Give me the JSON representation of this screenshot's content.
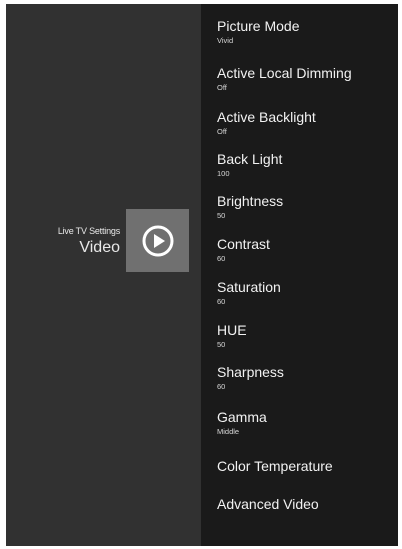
{
  "section": {
    "subtitle": "Live TV Settings",
    "title": "Video",
    "icon": "play-circle-icon"
  },
  "menu": {
    "items": [
      {
        "label": "Picture Mode",
        "value": "Vivid"
      },
      {
        "label": "Active Local Dimming",
        "value": "Off"
      },
      {
        "label": "Active Backlight",
        "value": "Off"
      },
      {
        "label": "Back Light",
        "value": "100"
      },
      {
        "label": "Brightness",
        "value": "50"
      },
      {
        "label": "Contrast",
        "value": "60"
      },
      {
        "label": "Saturation",
        "value": "60"
      },
      {
        "label": "HUE",
        "value": "50"
      },
      {
        "label": "Sharpness",
        "value": "60"
      },
      {
        "label": "Gamma",
        "value": "Middle"
      },
      {
        "label": "Color Temperature",
        "value": ""
      },
      {
        "label": "Advanced Video",
        "value": ""
      }
    ]
  },
  "colors": {
    "left_panel": "#313131",
    "right_panel": "#1a1a1a",
    "icon_tile": "#707070",
    "text": "#f2f2f2"
  }
}
